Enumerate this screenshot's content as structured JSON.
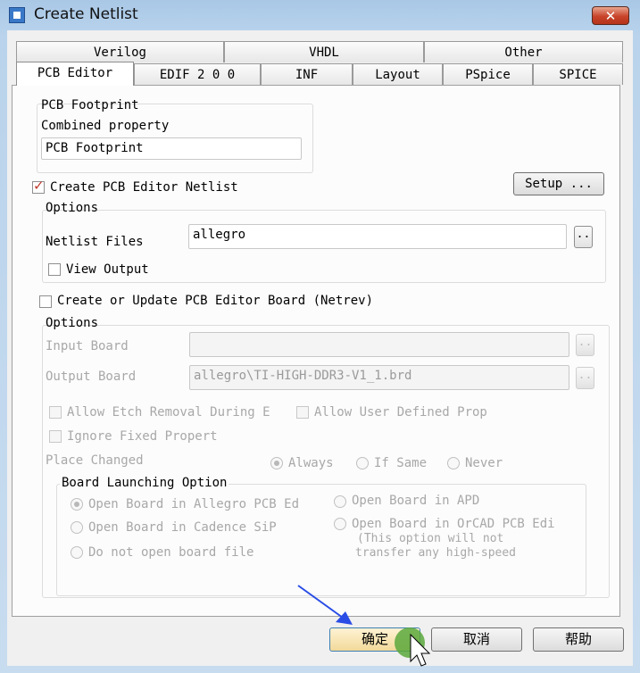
{
  "window": {
    "title": "Create Netlist",
    "close_symbol": "✕"
  },
  "tabs_back": [
    "Verilog",
    "VHDL",
    "Other"
  ],
  "tabs_front": [
    "PCB Editor",
    "EDIF 2 0 0",
    "INF",
    "Layout",
    "PSpice",
    "SPICE"
  ],
  "active_tab": "PCB Editor",
  "footprint": {
    "group_label": "PCB Footprint",
    "combined_label": "Combined property",
    "value": "PCB Footprint"
  },
  "setup_button": "Setup ...",
  "create_netlist": {
    "label": "Create PCB Editor Netlist",
    "checked": true
  },
  "options1": {
    "label": "Options",
    "netlist_files_label": "Netlist Files",
    "netlist_files_value": "allegro",
    "browse": "..",
    "view_output_label": "View Output",
    "view_output_checked": false
  },
  "create_board": {
    "label": "Create or Update PCB Editor Board (Netrev)",
    "checked": false
  },
  "options2": {
    "label": "Options",
    "input_board_label": "Input Board",
    "input_board_value": "",
    "output_board_label": "Output Board",
    "output_board_value": "allegro\\TI-HIGH-DDR3-V1_1.brd",
    "browse": "..",
    "allow_etch_label": "Allow Etch Removal During E",
    "allow_user_props_label": "Allow User Defined Prop",
    "ignore_fixed_label": "Ignore Fixed Propert",
    "place_changed_label": "Place Changed",
    "place_changed_options": [
      "Always",
      "If Same",
      "Never"
    ],
    "place_changed_selected": "Always"
  },
  "board_launching": {
    "label": "Board Launching Option",
    "options_left": [
      "Open Board in Allegro PCB Ed",
      "Open Board in Cadence SiP",
      "Do not open board file"
    ],
    "options_right": [
      "Open Board in APD",
      "Open Board in OrCAD PCB Edi"
    ],
    "selected": "Open Board in Allegro PCB Ed",
    "note_lines": [
      "(This option will not",
      "transfer any high-speed"
    ]
  },
  "buttons": {
    "ok": "确定",
    "cancel": "取消",
    "help": "帮助"
  },
  "colors": {
    "annotation_arrow": "#2a4de6",
    "cursor_highlight": "#5aa83c",
    "title_close": "#c8432a"
  }
}
